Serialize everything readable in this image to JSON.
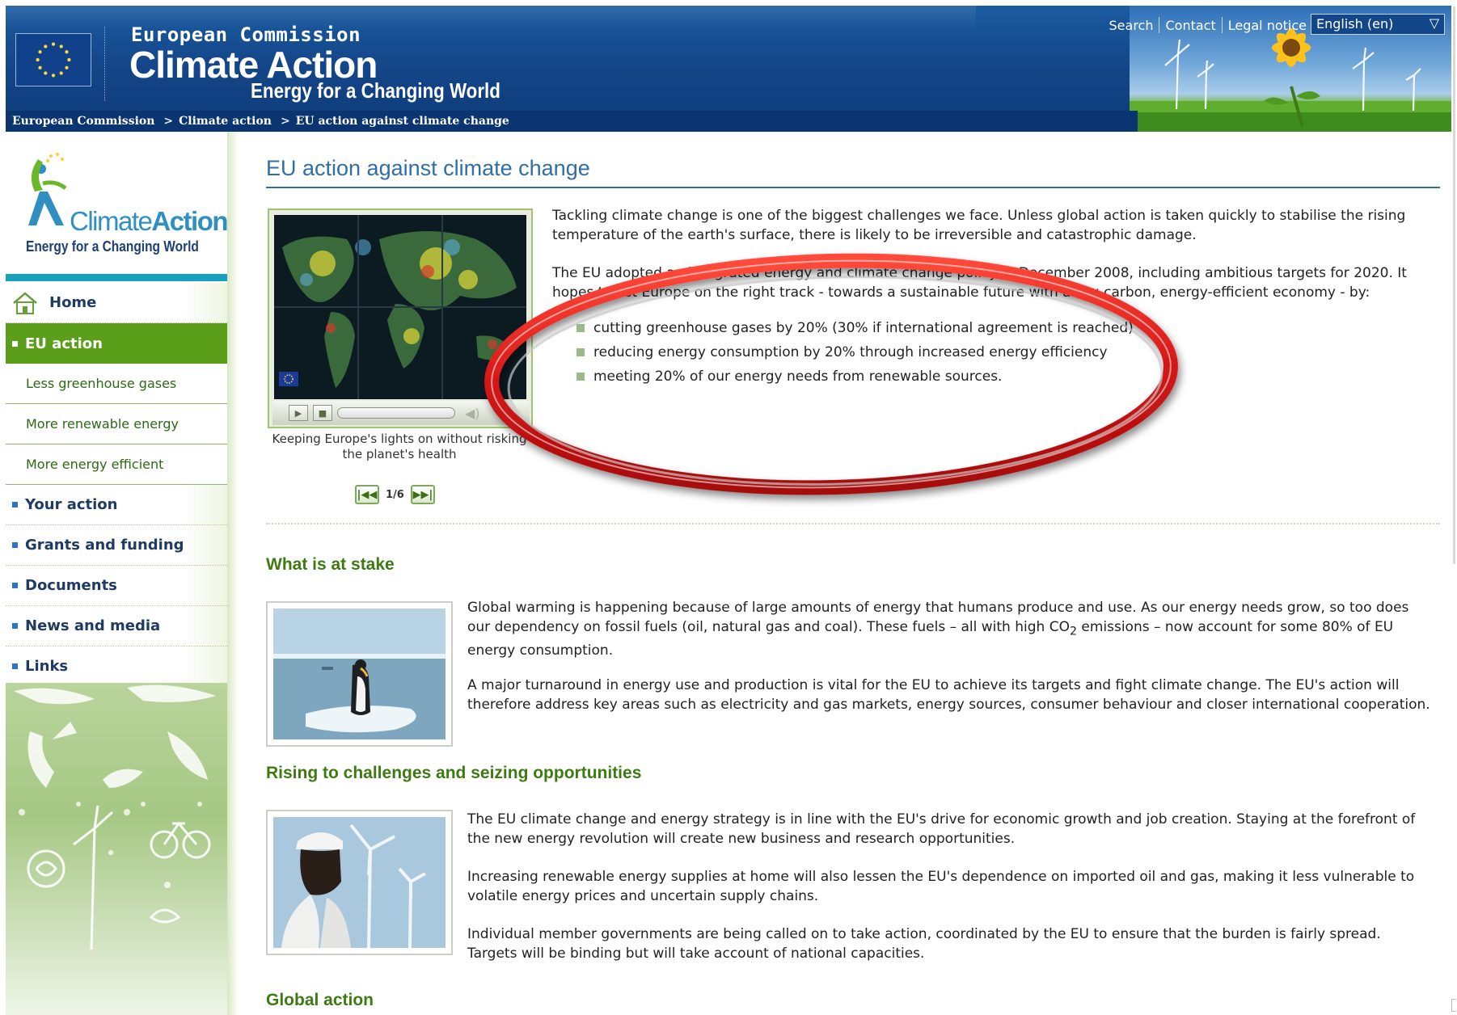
{
  "header": {
    "org_label": "European Commission",
    "site_title": "Climate Action",
    "tagline": "Energy for a Changing World",
    "top_links": [
      "Search",
      "Contact",
      "Legal notice"
    ],
    "language": "English (en)"
  },
  "breadcrumb": [
    "European Commission",
    "Climate action",
    "EU action against climate change"
  ],
  "sidebar": {
    "logo": {
      "word1": "Climate",
      "word2": "Action",
      "subtitle": "Energy for a Changing World"
    },
    "nav": {
      "home": "Home",
      "eu_action": "EU action",
      "sub_items": [
        "Less greenhouse gases",
        "More renewable energy",
        "More energy efficient"
      ],
      "items": [
        "Your action",
        "Grants and funding",
        "Documents",
        "News and media",
        "Links"
      ]
    }
  },
  "main": {
    "page_title": "EU action against climate change",
    "video": {
      "caption": "Keeping Europe's lights on without risking the planet's health",
      "pager": "1/6"
    },
    "intro_p1": "Tackling climate change is one of the biggest challenges we face. Unless global action is taken quickly to stabilise the rising temperature of the earth's surface, there is likely to be irreversible and catastrophic damage.",
    "intro_p2": "The EU adopted an integrated energy and climate change policy in December 2008, including ambitious targets for 2020. It hopes to set Europe on the right track - towards a sustainable future with a low-carbon, energy-efficient economy - by:",
    "targets": [
      "cutting greenhouse gases by 20% (30% if international agreement is reached)",
      "reducing energy consumption by 20% through increased energy efficiency",
      "meeting 20% of our energy needs from renewable sources."
    ],
    "sections": {
      "stake": {
        "heading": "What is at stake",
        "p1_a": "Global warming is happening because of large amounts of energy that humans produce and use. As our energy needs grow, so too does our dependency on fossil fuels (oil, natural gas and coal). These fuels – all with high CO",
        "p1_sub": "2",
        "p1_b": " emissions – now account for some 80% of EU energy consumption.",
        "p2": "A major turnaround in energy use and production is vital for the EU to achieve its targets and fight climate change. The EU's action will therefore address key areas such as electricity and gas markets, energy sources, consumer behaviour and closer international cooperation."
      },
      "challenges": {
        "heading": "Rising to challenges and seizing opportunities",
        "p1": "The EU climate change and energy strategy is in line with the EU's drive for economic growth and job creation. Staying at the forefront of the new energy revolution will create new business and research opportunities.",
        "p2": "Increasing renewable energy supplies at home will also lessen the EU's dependence on imported oil and gas, making it less vulnerable to volatile energy prices and uncertain supply chains.",
        "p3": "Individual member governments are being called on to take action,  coordinated by the EU to ensure that the burden is fairly spread. Targets will be binding but will take account of national capacities."
      },
      "global": {
        "heading": "Global action"
      }
    }
  },
  "colors": {
    "header_blue": "#14478a",
    "nav_active": "#5a9e1a",
    "section_heading": "#3d7a12",
    "title_blue": "#2f6ea8",
    "annotation_red": "#d81a1a"
  }
}
